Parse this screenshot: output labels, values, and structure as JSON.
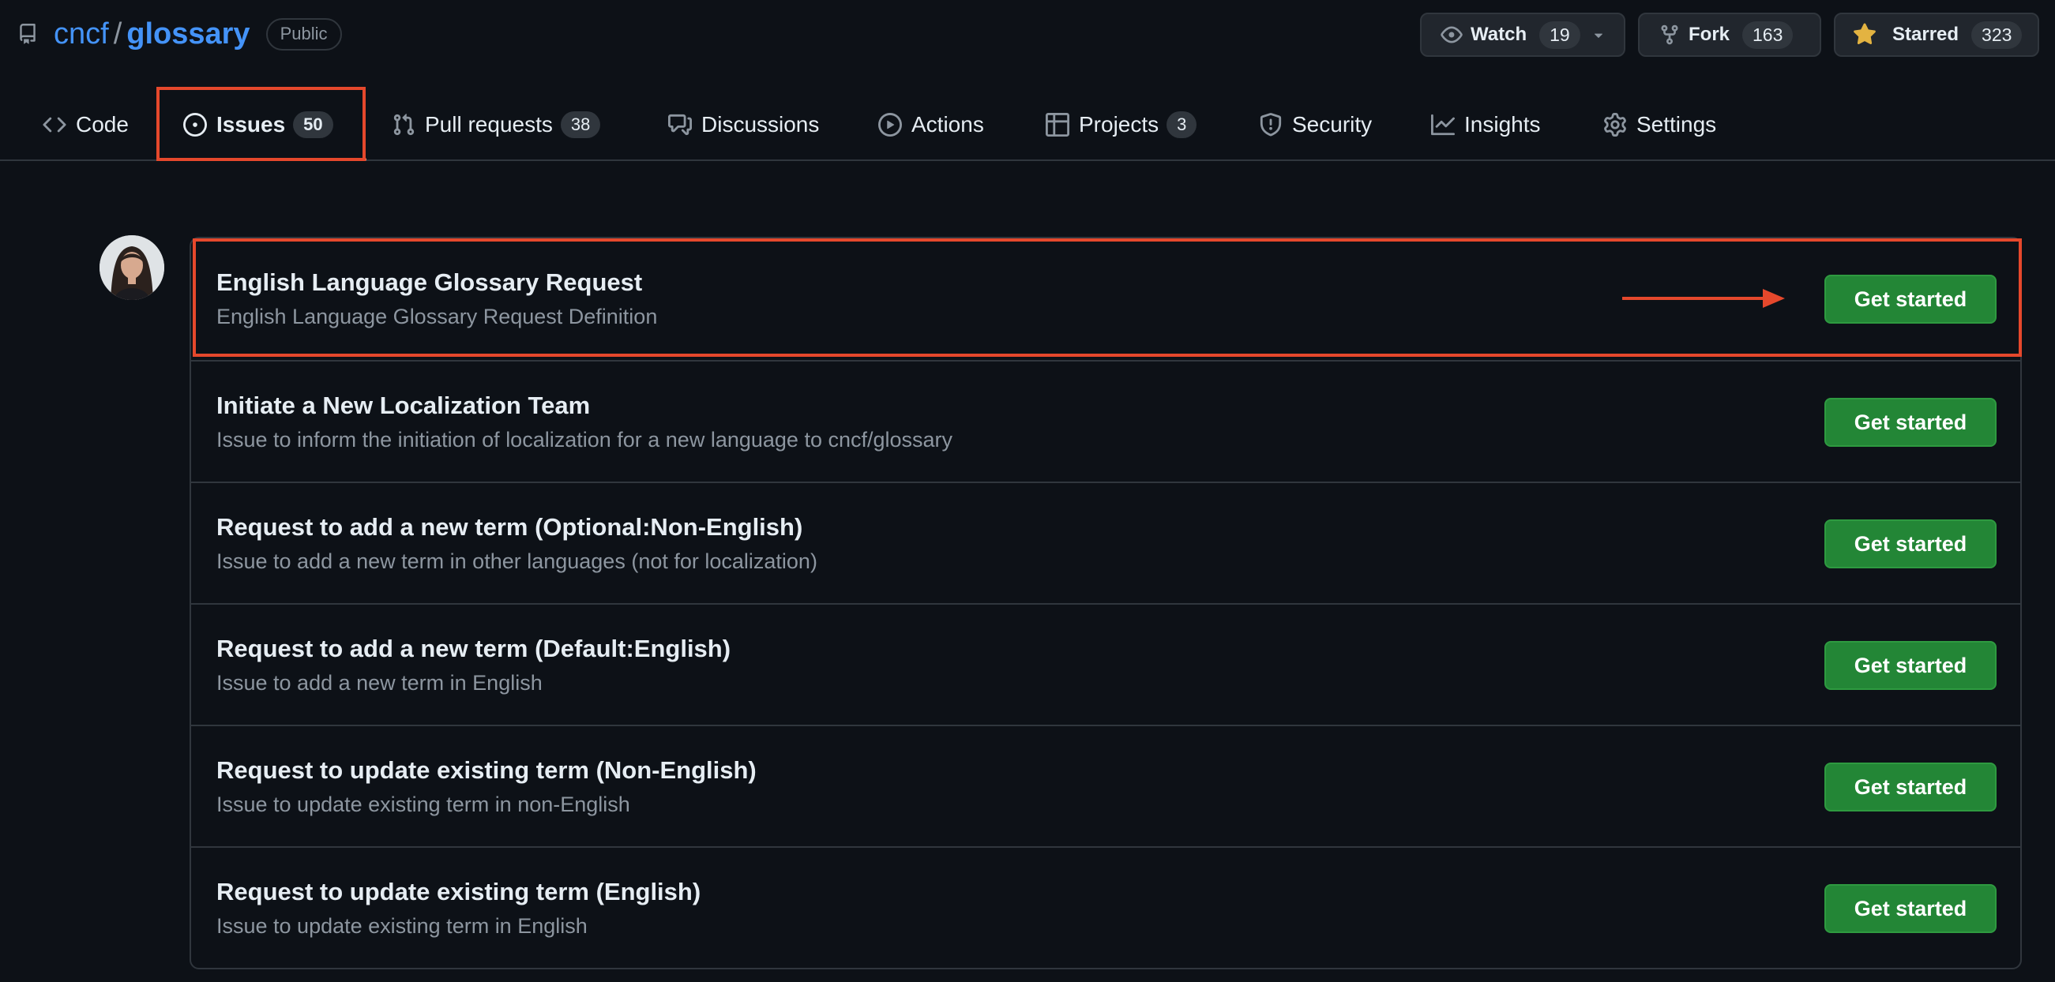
{
  "repo": {
    "owner": "cncf",
    "separator": "/",
    "name": "glossary",
    "visibility": "Public"
  },
  "actions": {
    "watch": {
      "label": "Watch",
      "count": "19",
      "icon": "eye-icon"
    },
    "fork": {
      "label": "Fork",
      "count": "163",
      "icon": "fork-icon"
    },
    "star": {
      "label": "Starred",
      "count": "323",
      "icon": "star-icon",
      "icon_color": "#e3b341"
    }
  },
  "tabs": [
    {
      "label": "Code",
      "icon": "code-icon",
      "count": ""
    },
    {
      "label": "Issues",
      "icon": "issue-icon",
      "count": "50",
      "active": true
    },
    {
      "label": "Pull requests",
      "icon": "pull-request-icon",
      "count": "38"
    },
    {
      "label": "Discussions",
      "icon": "discussion-icon",
      "count": ""
    },
    {
      "label": "Actions",
      "icon": "play-icon",
      "count": ""
    },
    {
      "label": "Projects",
      "icon": "table-icon",
      "count": "3"
    },
    {
      "label": "Security",
      "icon": "shield-icon",
      "count": ""
    },
    {
      "label": "Insights",
      "icon": "graph-icon",
      "count": ""
    },
    {
      "label": "Settings",
      "icon": "gear-icon",
      "count": ""
    }
  ],
  "templates": [
    {
      "title": "English Language Glossary Request",
      "description": "English Language Glossary Request Definition",
      "button": "Get started"
    },
    {
      "title": "Initiate a New Localization Team",
      "description": "Issue to inform the initiation of localization for a new language to cncf/glossary",
      "button": "Get started"
    },
    {
      "title": "Request to add a new term (Optional:Non-English)",
      "description": "Issue to add a new term in other languages (not for localization)",
      "button": "Get started"
    },
    {
      "title": "Request to add a new term (Default:English)",
      "description": "Issue to add a new term in English",
      "button": "Get started"
    },
    {
      "title": "Request to update existing term (Non-English)",
      "description": "Issue to update existing term in non-English",
      "button": "Get started"
    },
    {
      "title": "Request to update existing term (English)",
      "description": "Issue to update existing term in English",
      "button": "Get started"
    }
  ],
  "colors": {
    "background": "#0d1117",
    "link": "#4493f8",
    "primary_button": "#238636",
    "annotation": "#e5482c"
  }
}
